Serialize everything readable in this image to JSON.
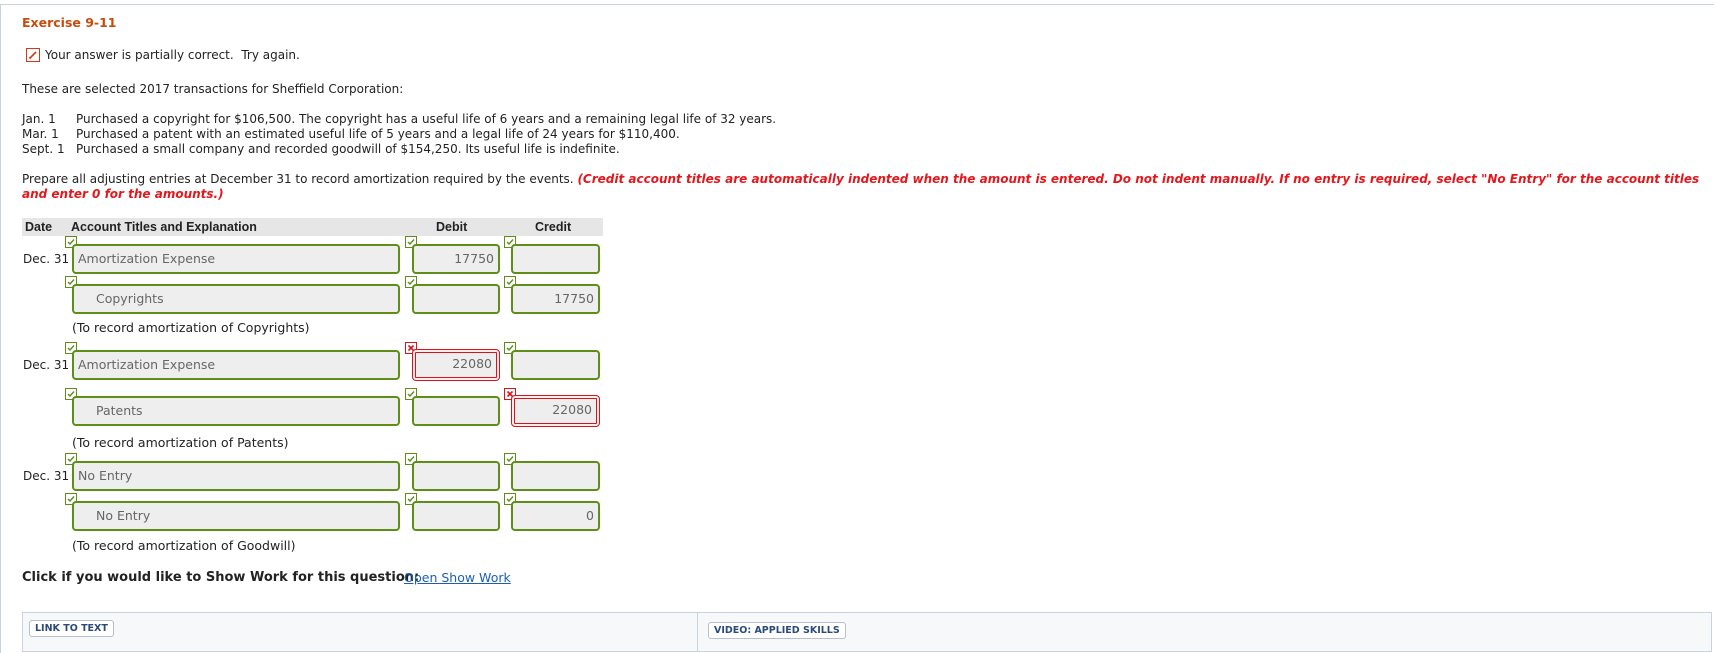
{
  "exercise_title": "Exercise 9-11",
  "status_message": "Your answer is partially correct.  Try again.",
  "intro": "These are selected 2017 transactions for Sheffield Corporation:",
  "transactions": [
    {
      "date": "Jan. 1",
      "text": "Purchased a copyright for $106,500. The copyright has a useful life of 6 years and a remaining legal life of 32 years."
    },
    {
      "date": "Mar. 1",
      "text": "Purchased a patent with an estimated useful life of 5 years and a legal life of 24 years for $110,400."
    },
    {
      "date": "Sept. 1",
      "text": "Purchased a small company and recorded goodwill of $154,250. Its useful life is indefinite."
    }
  ],
  "instructions": "Prepare all adjusting entries at December 31 to record amortization required by the events.",
  "instructions_note": "(Credit account titles are automatically indented when the amount is entered. Do not indent manually. If no entry is required, select \"No Entry\" for the account titles and enter 0 for the amounts.)",
  "table_headers": {
    "date": "Date",
    "account": "Account Titles and Explanation",
    "debit": "Debit",
    "credit": "Credit"
  },
  "entries": [
    {
      "date": "Dec. 31",
      "rows": [
        {
          "account": "Amortization Expense",
          "debit": "17750",
          "credit": "",
          "account_status": "correct",
          "debit_status": "correct",
          "credit_status": "correct"
        },
        {
          "account": "Copyrights",
          "debit": "",
          "credit": "17750",
          "account_status": "correct",
          "debit_status": "correct",
          "credit_status": "correct"
        }
      ],
      "note": "(To record amortization of Copyrights)"
    },
    {
      "date": "Dec. 31",
      "rows": [
        {
          "account": "Amortization Expense",
          "debit": "22080",
          "credit": "",
          "account_status": "correct",
          "debit_status": "incorrect",
          "credit_status": "correct"
        },
        {
          "account": "Patents",
          "debit": "",
          "credit": "22080",
          "account_status": "correct",
          "debit_status": "correct",
          "credit_status": "incorrect"
        }
      ],
      "note": "(To record amortization of Patents)"
    },
    {
      "date": "Dec. 31",
      "rows": [
        {
          "account": "No Entry",
          "debit": "",
          "credit": "",
          "account_status": "correct",
          "debit_status": "correct",
          "credit_status": "correct"
        },
        {
          "account": "No Entry",
          "debit": "",
          "credit": "0",
          "account_status": "correct",
          "debit_status": "correct",
          "credit_status": "correct"
        }
      ],
      "note": "(To record amortization of Goodwill)"
    }
  ],
  "show_work_prompt": "Click if you would like to Show Work for this question:",
  "show_work_link": "Open Show Work",
  "link_to_text": "LINK TO TEXT",
  "video_label": "VIDEO: APPLIED SKILLS",
  "colors": {
    "correct": "#5e8e18",
    "incorrect": "#d8141a",
    "title": "#c84b0b",
    "note_red": "#e3171c"
  }
}
